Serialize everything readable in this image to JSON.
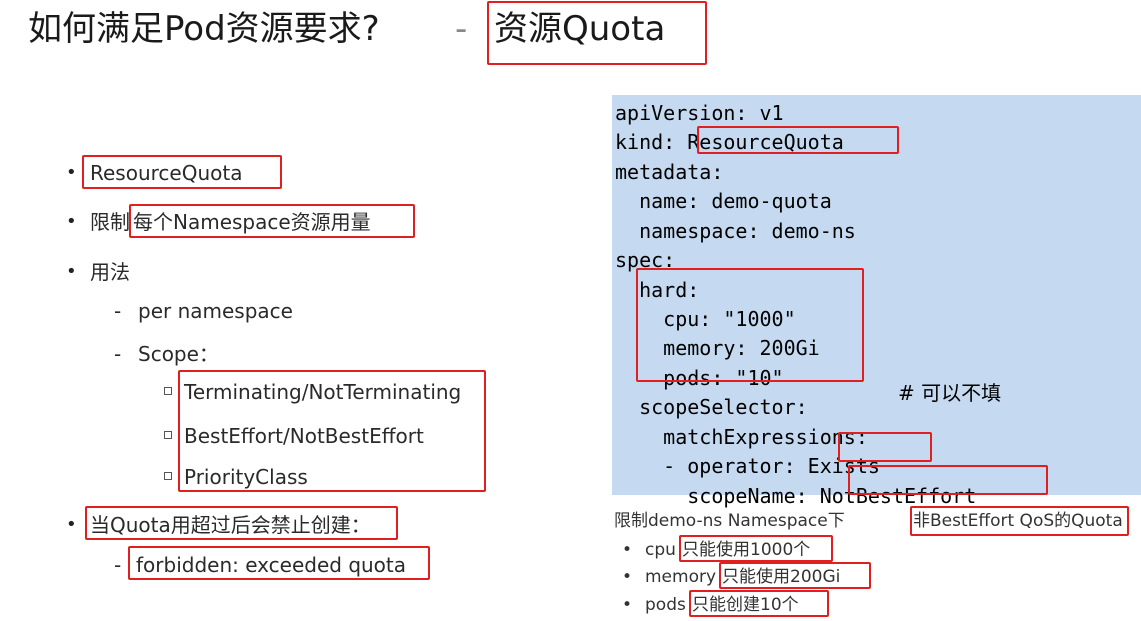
{
  "title": {
    "main": "如何满足Pod资源要求?",
    "dash": "-",
    "sub": "资源Quota"
  },
  "left": {
    "bullets": [
      {
        "text": "ResourceQuota"
      },
      {
        "prefix": "限制",
        "text": "每个Namespace资源用量"
      },
      {
        "text": "用法"
      }
    ],
    "usage": {
      "per_namespace": "per namespace",
      "scope_label": "Scope：",
      "scopes": [
        "Terminating/NotTerminating",
        "BestEffort/NotBestEffort",
        "PriorityClass"
      ]
    },
    "exceed": {
      "text": "当Quota用超过后会禁止创建：",
      "error": "forbidden: exceeded quota"
    },
    "bullet_char": "•",
    "dash_char": "-"
  },
  "yaml": {
    "lines": [
      "apiVersion: v1",
      "kind: ResourceQuota",
      "metadata:",
      "  name: demo-quota",
      "  namespace: demo-ns",
      "spec:",
      "  hard:",
      "    cpu: \"1000\"",
      "    memory: 200Gi",
      "    pods: \"10\"",
      "  scopeSelector:",
      "    matchExpressions:",
      "    - operator: Exists",
      "      scopeName: NotBestEffort"
    ],
    "comment": "# 可以不填"
  },
  "notes": {
    "heading_prefix": "限制demo-ns Namespace下",
    "heading_highlight": "非BestEffort QoS的Quota",
    "items": [
      {
        "prefix": "cpu",
        "highlight": "只能使用1000个"
      },
      {
        "prefix": "memory",
        "highlight": "只能使用200Gi"
      },
      {
        "prefix": "pods",
        "highlight": "只能创建10个"
      }
    ]
  },
  "colors": {
    "highlight_border": "#e02020",
    "code_background": "#c5daf0"
  }
}
